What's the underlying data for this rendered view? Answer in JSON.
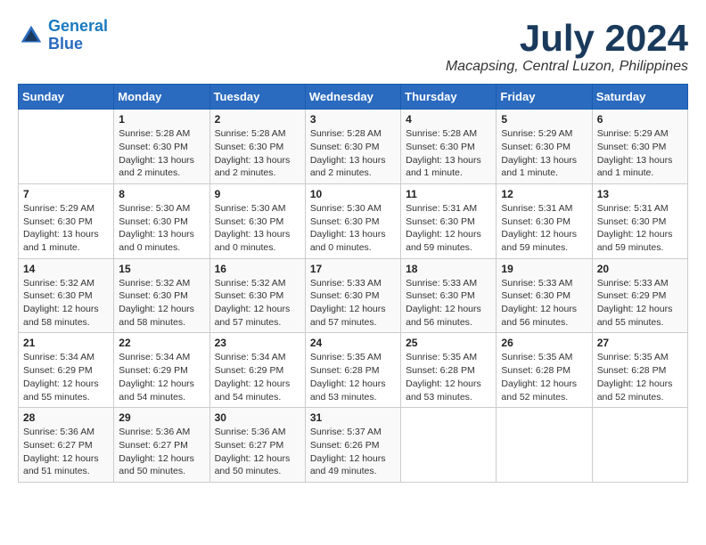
{
  "header": {
    "logo_line1": "General",
    "logo_line2": "Blue",
    "month_title": "July 2024",
    "location": "Macapsing, Central Luzon, Philippines"
  },
  "weekdays": [
    "Sunday",
    "Monday",
    "Tuesday",
    "Wednesday",
    "Thursday",
    "Friday",
    "Saturday"
  ],
  "weeks": [
    [
      {
        "day": "",
        "info": ""
      },
      {
        "day": "1",
        "info": "Sunrise: 5:28 AM\nSunset: 6:30 PM\nDaylight: 13 hours\nand 2 minutes."
      },
      {
        "day": "2",
        "info": "Sunrise: 5:28 AM\nSunset: 6:30 PM\nDaylight: 13 hours\nand 2 minutes."
      },
      {
        "day": "3",
        "info": "Sunrise: 5:28 AM\nSunset: 6:30 PM\nDaylight: 13 hours\nand 2 minutes."
      },
      {
        "day": "4",
        "info": "Sunrise: 5:28 AM\nSunset: 6:30 PM\nDaylight: 13 hours\nand 1 minute."
      },
      {
        "day": "5",
        "info": "Sunrise: 5:29 AM\nSunset: 6:30 PM\nDaylight: 13 hours\nand 1 minute."
      },
      {
        "day": "6",
        "info": "Sunrise: 5:29 AM\nSunset: 6:30 PM\nDaylight: 13 hours\nand 1 minute."
      }
    ],
    [
      {
        "day": "7",
        "info": "Sunrise: 5:29 AM\nSunset: 6:30 PM\nDaylight: 13 hours\nand 1 minute."
      },
      {
        "day": "8",
        "info": "Sunrise: 5:30 AM\nSunset: 6:30 PM\nDaylight: 13 hours\nand 0 minutes."
      },
      {
        "day": "9",
        "info": "Sunrise: 5:30 AM\nSunset: 6:30 PM\nDaylight: 13 hours\nand 0 minutes."
      },
      {
        "day": "10",
        "info": "Sunrise: 5:30 AM\nSunset: 6:30 PM\nDaylight: 13 hours\nand 0 minutes."
      },
      {
        "day": "11",
        "info": "Sunrise: 5:31 AM\nSunset: 6:30 PM\nDaylight: 12 hours\nand 59 minutes."
      },
      {
        "day": "12",
        "info": "Sunrise: 5:31 AM\nSunset: 6:30 PM\nDaylight: 12 hours\nand 59 minutes."
      },
      {
        "day": "13",
        "info": "Sunrise: 5:31 AM\nSunset: 6:30 PM\nDaylight: 12 hours\nand 59 minutes."
      }
    ],
    [
      {
        "day": "14",
        "info": "Sunrise: 5:32 AM\nSunset: 6:30 PM\nDaylight: 12 hours\nand 58 minutes."
      },
      {
        "day": "15",
        "info": "Sunrise: 5:32 AM\nSunset: 6:30 PM\nDaylight: 12 hours\nand 58 minutes."
      },
      {
        "day": "16",
        "info": "Sunrise: 5:32 AM\nSunset: 6:30 PM\nDaylight: 12 hours\nand 57 minutes."
      },
      {
        "day": "17",
        "info": "Sunrise: 5:33 AM\nSunset: 6:30 PM\nDaylight: 12 hours\nand 57 minutes."
      },
      {
        "day": "18",
        "info": "Sunrise: 5:33 AM\nSunset: 6:30 PM\nDaylight: 12 hours\nand 56 minutes."
      },
      {
        "day": "19",
        "info": "Sunrise: 5:33 AM\nSunset: 6:30 PM\nDaylight: 12 hours\nand 56 minutes."
      },
      {
        "day": "20",
        "info": "Sunrise: 5:33 AM\nSunset: 6:29 PM\nDaylight: 12 hours\nand 55 minutes."
      }
    ],
    [
      {
        "day": "21",
        "info": "Sunrise: 5:34 AM\nSunset: 6:29 PM\nDaylight: 12 hours\nand 55 minutes."
      },
      {
        "day": "22",
        "info": "Sunrise: 5:34 AM\nSunset: 6:29 PM\nDaylight: 12 hours\nand 54 minutes."
      },
      {
        "day": "23",
        "info": "Sunrise: 5:34 AM\nSunset: 6:29 PM\nDaylight: 12 hours\nand 54 minutes."
      },
      {
        "day": "24",
        "info": "Sunrise: 5:35 AM\nSunset: 6:28 PM\nDaylight: 12 hours\nand 53 minutes."
      },
      {
        "day": "25",
        "info": "Sunrise: 5:35 AM\nSunset: 6:28 PM\nDaylight: 12 hours\nand 53 minutes."
      },
      {
        "day": "26",
        "info": "Sunrise: 5:35 AM\nSunset: 6:28 PM\nDaylight: 12 hours\nand 52 minutes."
      },
      {
        "day": "27",
        "info": "Sunrise: 5:35 AM\nSunset: 6:28 PM\nDaylight: 12 hours\nand 52 minutes."
      }
    ],
    [
      {
        "day": "28",
        "info": "Sunrise: 5:36 AM\nSunset: 6:27 PM\nDaylight: 12 hours\nand 51 minutes."
      },
      {
        "day": "29",
        "info": "Sunrise: 5:36 AM\nSunset: 6:27 PM\nDaylight: 12 hours\nand 50 minutes."
      },
      {
        "day": "30",
        "info": "Sunrise: 5:36 AM\nSunset: 6:27 PM\nDaylight: 12 hours\nand 50 minutes."
      },
      {
        "day": "31",
        "info": "Sunrise: 5:37 AM\nSunset: 6:26 PM\nDaylight: 12 hours\nand 49 minutes."
      },
      {
        "day": "",
        "info": ""
      },
      {
        "day": "",
        "info": ""
      },
      {
        "day": "",
        "info": ""
      }
    ]
  ]
}
